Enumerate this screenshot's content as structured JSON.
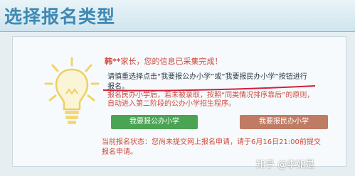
{
  "header": {
    "title": "选择报名类型"
  },
  "greeting": {
    "name": "韩**",
    "text": "家长，您的信息已采集完成！"
  },
  "instructions": {
    "line1": "请慎重选择点击“我要报公办小学”或“我要报民办小学”按钮进行",
    "line2": "报名。",
    "line3": "报名民办小学后，若未被录取，按照“同类情况排序靠后”的原则，",
    "line4": "自动进入第二阶段的公办小学招生程序。"
  },
  "buttons": {
    "public": "我要报公办小学",
    "private": "我要报民办小学"
  },
  "status": {
    "line1": "当前报名状态：您尚未提交网上报名申请，请于6月16日21:00前提交",
    "line2": "报名申请。"
  },
  "watermark": {
    "text": "知乎 @李如是"
  },
  "colors": {
    "title": "#3f89b3",
    "accent_red": "#d04a3e",
    "green": "#4aa454",
    "brown": "#c07b64"
  },
  "icons": {
    "bulb": "lightbulb-icon"
  }
}
